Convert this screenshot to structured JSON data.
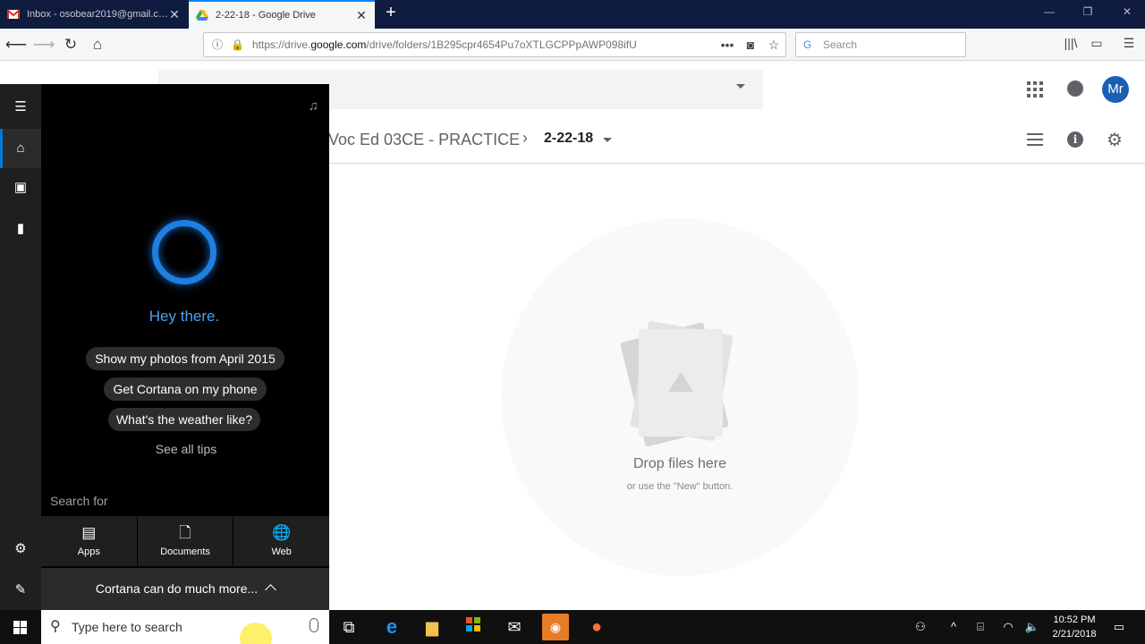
{
  "browser": {
    "tabs": [
      {
        "title": "Inbox - osobear2019@gmail.com",
        "favicon": "gmail-icon",
        "active": false
      },
      {
        "title": "2-22-18 - Google Drive",
        "favicon": "google-drive-icon",
        "active": true
      }
    ],
    "url_prefix": "https://drive.",
    "url_domain": "google.com",
    "url_path": "/drive/folders/1B295cpr4654Pu7oXTLGCPPpAWP098ifU",
    "search_placeholder": "Search",
    "accent_color": "#0a84ff"
  },
  "drive": {
    "avatar_initials": "Mr",
    "breadcrumb_parent": "Voc Ed 03CE - PRACTICE",
    "breadcrumb_current": "2-22-18",
    "drop_title": "Drop files here",
    "drop_subtitle": "or use the \"New\" button."
  },
  "cortana": {
    "greeting": "Hey there.",
    "tips": [
      "Show my photos from April 2015",
      "Get Cortana on my phone",
      "What's the weather like?"
    ],
    "see_all_tips": "See all tips",
    "search_for_label": "Search for",
    "scopes": [
      {
        "label": "Apps",
        "icon": "apps-window-icon"
      },
      {
        "label": "Documents",
        "icon": "document-icon"
      },
      {
        "label": "Web",
        "icon": "globe-icon"
      }
    ],
    "more_label": "Cortana can do much more...",
    "ring_color": "#1f7fe0"
  },
  "taskbar": {
    "search_placeholder": "Type here to search",
    "time": "10:52 PM",
    "date": "2/21/2018"
  }
}
